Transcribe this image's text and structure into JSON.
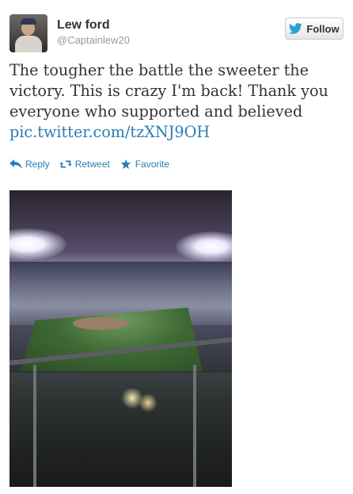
{
  "user": {
    "name": "Lew ford",
    "handle": "@Captainlew20"
  },
  "follow": {
    "label": "Follow"
  },
  "tweet": {
    "text": "The tougher the battle the sweeter the victory. This is crazy I'm back! Thank you everyone who supported and believed",
    "link": "pic.twitter.com/tzXNJ9OH"
  },
  "actions": {
    "reply": "Reply",
    "retweet": "Retweet",
    "favorite": "Favorite"
  },
  "colors": {
    "link": "#2a7db4",
    "text": "#333333",
    "muted": "#999999",
    "twitter_blue": "#2a9fd8"
  },
  "icons": {
    "follow": "twitter-bird-icon",
    "reply": "reply-arrow-icon",
    "retweet": "retweet-icon",
    "favorite": "star-icon"
  }
}
